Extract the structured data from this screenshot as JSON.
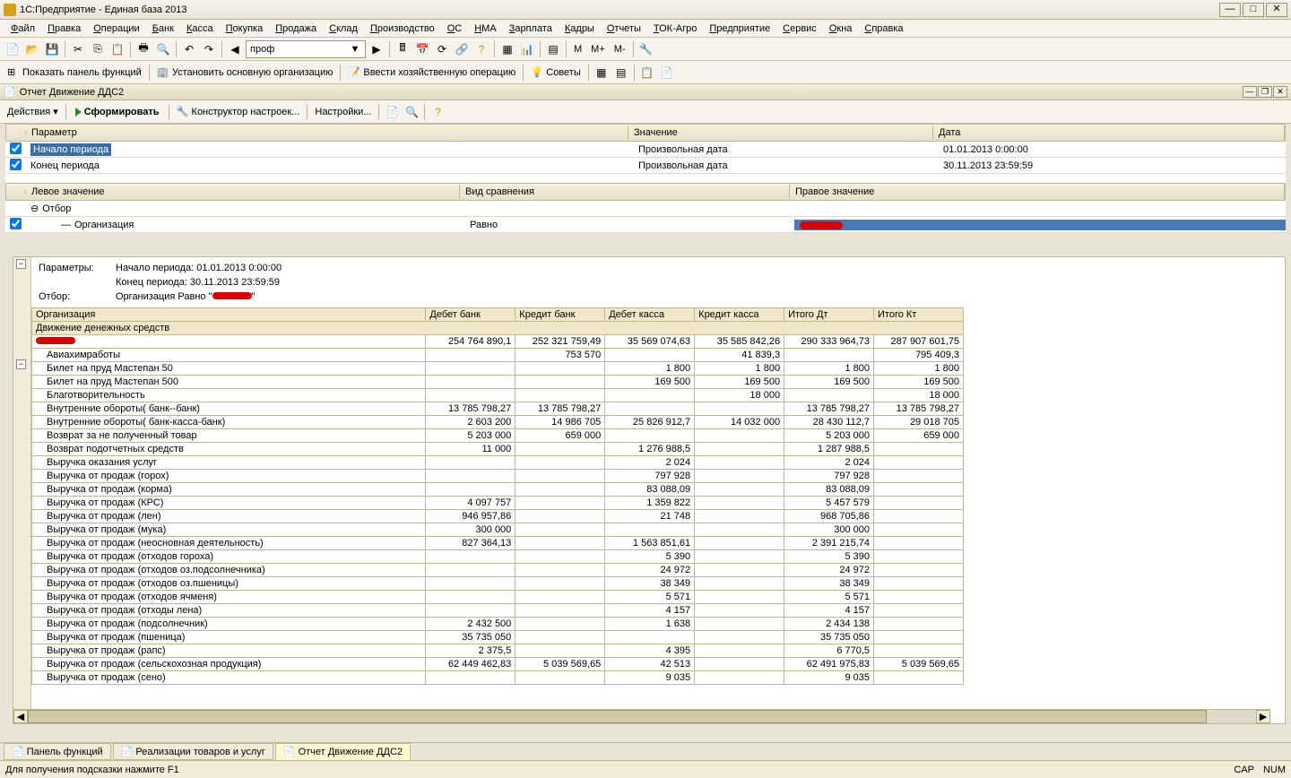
{
  "window": {
    "title": "1С:Предприятие - Единая база 2013"
  },
  "menu": [
    "Файл",
    "Правка",
    "Операции",
    "Банк",
    "Касса",
    "Покупка",
    "Продажа",
    "Склад",
    "Производство",
    "ОС",
    "НМА",
    "Зарплата",
    "Кадры",
    "Отчеты",
    "ТОК-Агро",
    "Предприятие",
    "Сервис",
    "Окна",
    "Справка"
  ],
  "toolbar1": {
    "combo_value": "проф",
    "m_buttons": [
      "M",
      "M+",
      "M-"
    ]
  },
  "toolbar2": {
    "show_panel": "Показать панель функций",
    "set_org": "Установить основную организацию",
    "enter_op": "Ввести хозяйственную операцию",
    "advice": "Советы"
  },
  "subwindow": {
    "title": "Отчет  Движение  ДДС2"
  },
  "report_toolbar": {
    "actions": "Действия",
    "run": "Сформировать",
    "designer": "Конструктор настроек...",
    "settings": "Настройки..."
  },
  "param_headers": {
    "p": "Параметр",
    "v": "Значение",
    "d": "Дата"
  },
  "params": [
    {
      "checked": true,
      "name": "Начало периода",
      "value": "Произвольная дата",
      "date": "01.01.2013 0:00:00",
      "selected": true
    },
    {
      "checked": true,
      "name": "Конец периода",
      "value": "Произвольная дата",
      "date": "30.11.2013 23:59:59",
      "selected": false
    }
  ],
  "filter_headers": {
    "l": "Левое значение",
    "c": "Вид сравнения",
    "r": "Правое значение"
  },
  "filters": {
    "root": "Отбор",
    "row": {
      "checked": true,
      "left": "Организация",
      "comp": "Равно"
    }
  },
  "report_header": {
    "params_lbl": "Параметры:",
    "start": "Начало периода: 01.01.2013 0:00:00",
    "end": "Конец периода: 30.11.2013 23:59:59",
    "filter_lbl": "Отбор:",
    "filter_txt": "Организация Равно \""
  },
  "columns": [
    "Организация",
    "Дебет банк",
    "Кредит банк",
    "Дебет касса",
    "Кредит касса",
    "Итого Дт",
    "Итого Кт"
  ],
  "subheader": "Движение денежных средств",
  "total_row": [
    "",
    "254 764 890,1",
    "252 321 759,49",
    "35 569 074,63",
    "35 585 842,26",
    "290 333 964,73",
    "287 907 601,75"
  ],
  "rows": [
    [
      "Авиахимработы",
      "",
      "753 570",
      "",
      "41 839,3",
      "",
      "795 409,3"
    ],
    [
      "Билет на пруд Мастепан 50",
      "",
      "",
      "1 800",
      "1 800",
      "1 800",
      "1 800"
    ],
    [
      "Билет на пруд Мастепан 500",
      "",
      "",
      "169 500",
      "169 500",
      "169 500",
      "169 500"
    ],
    [
      "Благотворительность",
      "",
      "",
      "",
      "18 000",
      "",
      "18 000"
    ],
    [
      "Внутренние обороты( банк--банк)",
      "13 785 798,27",
      "13 785 798,27",
      "",
      "",
      "13 785 798,27",
      "13 785 798,27"
    ],
    [
      "Внутренние обороты( банк-касса-банк)",
      "2 603 200",
      "14 986 705",
      "25 826 912,7",
      "14 032 000",
      "28 430 112,7",
      "29 018 705"
    ],
    [
      "Возврат за не полученный товар",
      "5 203 000",
      "659 000",
      "",
      "",
      "5 203 000",
      "659 000"
    ],
    [
      "Возврат подотчетных средств",
      "11 000",
      "",
      "1 276 988,5",
      "",
      "1 287 988,5",
      ""
    ],
    [
      "Выручка оказания услуг",
      "",
      "",
      "2 024",
      "",
      "2 024",
      ""
    ],
    [
      "Выручка от продаж (горох)",
      "",
      "",
      "797 928",
      "",
      "797 928",
      ""
    ],
    [
      "Выручка от продаж (корма)",
      "",
      "",
      "83 088,09",
      "",
      "83 088,09",
      ""
    ],
    [
      "Выручка от продаж (КРС)",
      "4 097 757",
      "",
      "1 359 822",
      "",
      "5 457 579",
      ""
    ],
    [
      "Выручка от продаж (лен)",
      "946 957,86",
      "",
      "21 748",
      "",
      "968 705,86",
      ""
    ],
    [
      "Выручка от продаж (мука)",
      "300 000",
      "",
      "",
      "",
      "300 000",
      ""
    ],
    [
      "Выручка от продаж (неосновная деятельность)",
      "827 364,13",
      "",
      "1 563 851,61",
      "",
      "2 391 215,74",
      ""
    ],
    [
      "Выручка от продаж (отходов гороха)",
      "",
      "",
      "5 390",
      "",
      "5 390",
      ""
    ],
    [
      "Выручка от продаж (отходов оз.подсолнечника)",
      "",
      "",
      "24 972",
      "",
      "24 972",
      ""
    ],
    [
      "Выручка от продаж (отходов оз.пшеницы)",
      "",
      "",
      "38 349",
      "",
      "38 349",
      ""
    ],
    [
      "Выручка от продаж (отходов ячменя)",
      "",
      "",
      "5 571",
      "",
      "5 571",
      ""
    ],
    [
      "Выручка от продаж (отходы лена)",
      "",
      "",
      "4 157",
      "",
      "4 157",
      ""
    ],
    [
      "Выручка от продаж (подсолнечник)",
      "2 432 500",
      "",
      "1 638",
      "",
      "2 434 138",
      ""
    ],
    [
      "Выручка от продаж (пшеница)",
      "35 735 050",
      "",
      "",
      "",
      "35 735 050",
      ""
    ],
    [
      "Выручка от продаж (рапс)",
      "2 375,5",
      "",
      "4 395",
      "",
      "6 770,5",
      ""
    ],
    [
      "Выручка от продаж (сельскохозная продукция)",
      "62 449 462,83",
      "5 039 569,65",
      "42 513",
      "",
      "62 491 975,83",
      "5 039 569,65"
    ],
    [
      "Выручка от продаж (сено)",
      "",
      "",
      "9 035",
      "",
      "9 035",
      ""
    ]
  ],
  "tabs": [
    {
      "label": "Панель функций",
      "active": false
    },
    {
      "label": "Реализации товаров и услуг",
      "active": false
    },
    {
      "label": "Отчет  Движение  ДДС2",
      "active": true
    }
  ],
  "status": {
    "hint": "Для получения подсказки нажмите F1",
    "cap": "CAP",
    "num": "NUM"
  }
}
